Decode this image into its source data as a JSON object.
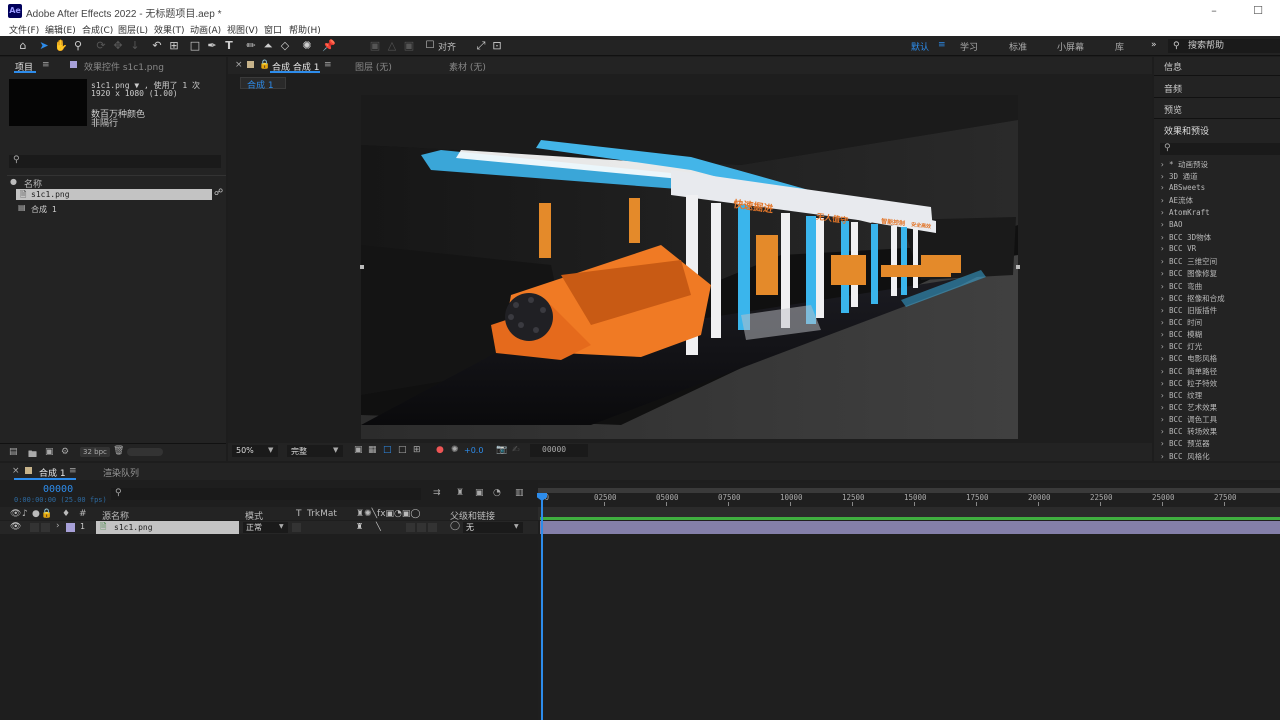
{
  "app": {
    "title": "Adobe After Effects 2022 - 无标题项目.aep *",
    "icon_label": "Ae"
  },
  "menu": [
    "文件(F)",
    "编辑(E)",
    "合成(C)",
    "图层(L)",
    "效果(T)",
    "动画(A)",
    "视图(V)",
    "窗口",
    "帮助(H)"
  ],
  "toolbar": {
    "snap_label": "对齐",
    "workspaces": [
      "默认",
      "学习",
      "标准",
      "小屏幕",
      "库"
    ],
    "active_workspace": "默认",
    "search_help": "搜索帮助"
  },
  "project": {
    "tab": "项目",
    "effects_tab": "效果控件 s1c1.png",
    "asset_name": "s1c1.png ▼ , 使用了 1 次",
    "asset_size": "1920 x 1080 (1.00)",
    "asset_colors": "数百万种颜色",
    "asset_interlace": "非隔行",
    "search_placeholder": "",
    "column_name": "名称",
    "items": [
      {
        "name": "s1c1.png",
        "kind": "footage"
      },
      {
        "name": "合成 1",
        "kind": "composition"
      }
    ],
    "bpc": "32 bpc"
  },
  "composition": {
    "tab": "合成 合成 1",
    "layer_tab": "图层 (无)",
    "footage_tab": "素材 (无)",
    "breadcrumb": "合成 1",
    "zoom": "50%",
    "resolution": "完整",
    "exposure": "+0.0",
    "timecode": "00000",
    "signs": [
      "快速掘进",
      "无人值守",
      "智能控制",
      "安全高效"
    ]
  },
  "right_panel": {
    "info": "信息",
    "audio": "音频",
    "preview": "预览",
    "effects_presets": "效果和预设",
    "effects": [
      "* 动画预设",
      "3D 通道",
      "ABSweets",
      "AE流体",
      "AtomKraft",
      "BAO",
      "BCC 3D物体",
      "BCC VR",
      "BCC 三维空间",
      "BCC 图像修复",
      "BCC 弯曲",
      "BCC 抠像和合成",
      "BCC 旧版插件",
      "BCC 时间",
      "BCC 模糊",
      "BCC 灯光",
      "BCC 电影风格",
      "BCC 简单路径",
      "BCC 粒子特效",
      "BCC 纹理",
      "BCC 艺术效果",
      "BCC 调色工具",
      "BCC 转场效果",
      "BCC 预览器",
      "BCC 风格化"
    ]
  },
  "timeline": {
    "tab": "合成 1",
    "render_queue": "渲染队列",
    "timecode": "00000",
    "timecode_sub": "0:00:00:00 (25.00 fps)",
    "columns": {
      "source_name": "源名称",
      "mode": "模式",
      "t": "T",
      "trkmat": "TrkMat",
      "parent": "父级和链接"
    },
    "ruler": [
      "00",
      "02500",
      "05000",
      "07500",
      "10000",
      "12500",
      "15000",
      "17500",
      "20000",
      "22500",
      "25000",
      "27500"
    ],
    "layers": [
      {
        "index": "1",
        "name": "s1c1.png",
        "mode": "正常",
        "parent": "无"
      }
    ],
    "playhead_frame": 0
  },
  "colors": {
    "accent": "#2d8ceb",
    "label_lavender": "#a7a0d8",
    "track_green": "#3fae3f"
  }
}
